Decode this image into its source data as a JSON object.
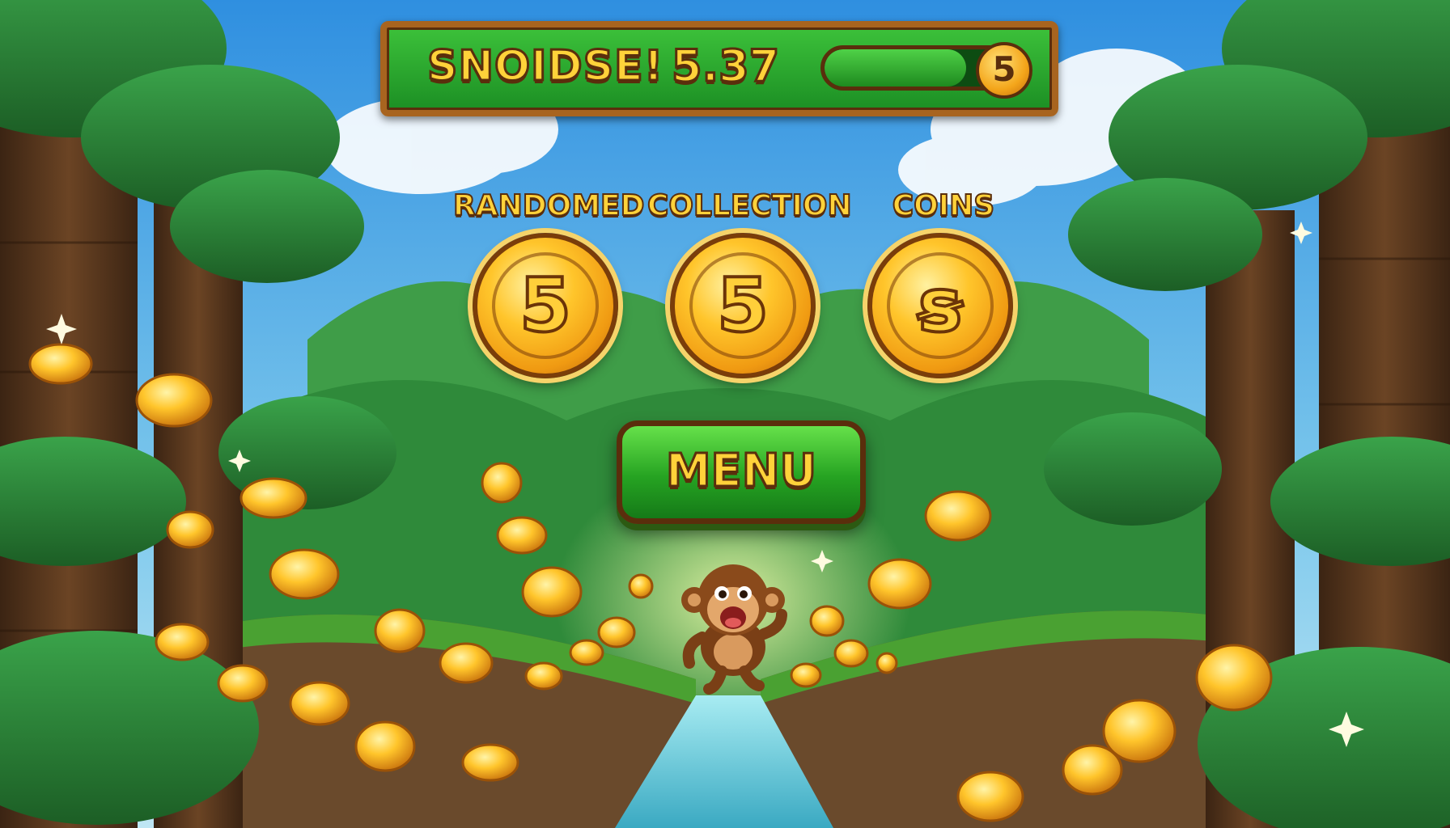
{
  "hud": {
    "title": "SNOIDSE!",
    "score": "5.37",
    "progress_fraction": 0.7,
    "badge": "5"
  },
  "rewards": [
    {
      "label": "RANDOMED",
      "coin_symbol": "5"
    },
    {
      "label": "COLLECTION",
      "coin_symbol": "5"
    },
    {
      "label": "COINS",
      "coin_symbol": "ꞩ"
    }
  ],
  "menu": {
    "label": "MENU"
  },
  "colors": {
    "sky_top": "#2f8fe0",
    "sky_bottom": "#bfe6f4",
    "jungle_green": "#2f8a2c",
    "gold": "#ffc52b",
    "frame_wood": "#a8641f",
    "button_green": "#26a322",
    "text_gold": "#ffd23a",
    "river": "#59c7d6"
  },
  "icons": {
    "character": "monkey-icon",
    "coin": "gold-coin-icon",
    "sparkle": "sparkle-icon"
  }
}
